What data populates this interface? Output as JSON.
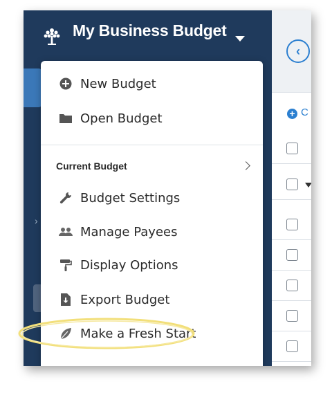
{
  "app": {
    "title": "My Business Budget"
  },
  "main": {
    "add_label": "C",
    "back_icon": "chevron-left-icon"
  },
  "menu": {
    "items_top": [
      {
        "label": "New Budget",
        "icon": "plus-circle-icon"
      },
      {
        "label": "Open Budget",
        "icon": "folder-icon",
        "submenu_icon": "chevron-right-icon"
      }
    ],
    "section_heading": "Current Budget",
    "items_current": [
      {
        "label": "Budget Settings",
        "icon": "wrench-icon"
      },
      {
        "label": "Manage Payees",
        "icon": "people-icon"
      },
      {
        "label": "Display Options",
        "icon": "paint-roller-icon"
      },
      {
        "label": "Export Budget",
        "icon": "file-download-icon"
      },
      {
        "label": "Make a Fresh Start",
        "icon": "leaf-icon",
        "highlighted": true
      }
    ]
  },
  "colors": {
    "sidebar": "#1f3a5c",
    "accent": "#2b7fd0",
    "highlight_ring": "#f2df7a"
  }
}
